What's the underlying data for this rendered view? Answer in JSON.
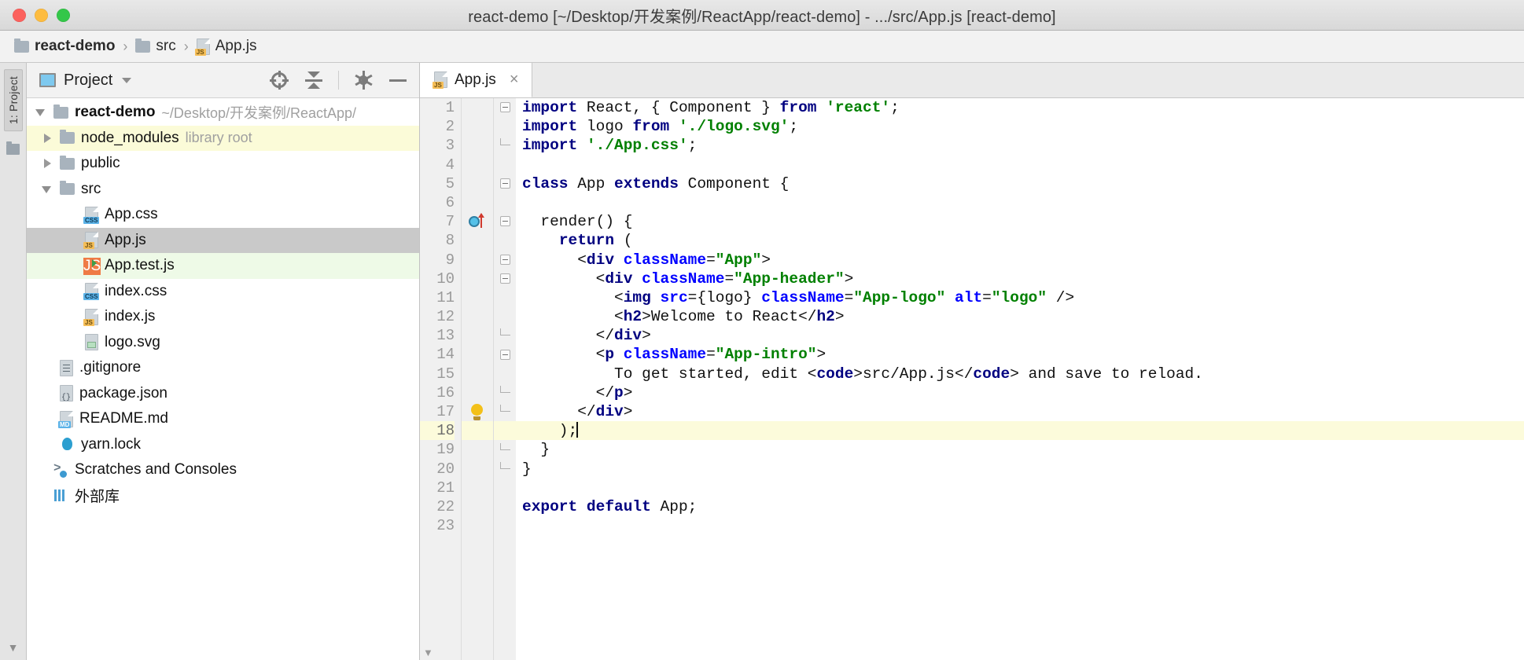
{
  "window": {
    "title": "react-demo [~/Desktop/开发案例/ReactApp/react-demo] - .../src/App.js [react-demo]",
    "controls": {
      "close": "close-button",
      "minimize": "minimize-button",
      "maximize": "maximize-button"
    }
  },
  "breadcrumb": {
    "items": [
      {
        "label": "react-demo",
        "icon": "folder-icon",
        "bold": true
      },
      {
        "label": "src",
        "icon": "folder-icon",
        "bold": false
      },
      {
        "label": "App.js",
        "icon": "js-file-icon",
        "bold": false
      }
    ],
    "separator": "›"
  },
  "toolstrip": {
    "tab_label": "1: Project"
  },
  "project_panel": {
    "title": "Project",
    "dropdown_caret": "▾",
    "actions": [
      {
        "name": "locate-in-tree-button",
        "icon": "target-icon"
      },
      {
        "name": "collapse-all-button",
        "icon": "collapse-all-icon"
      },
      {
        "name": "settings-button",
        "icon": "gear-icon"
      },
      {
        "name": "hide-panel-button",
        "icon": "minimize-icon"
      }
    ],
    "tree": [
      {
        "label": "react-demo",
        "meta": "~/Desktop/开发案例/ReactApp/",
        "icon": "folder-icon",
        "twisty": "open",
        "indent": 0,
        "bold": true,
        "state": "none"
      },
      {
        "label": "node_modules",
        "meta": "library root",
        "icon": "folder-icon",
        "twisty": "closed",
        "indent": 1,
        "bold": false,
        "state": "yellow"
      },
      {
        "label": "public",
        "meta": "",
        "icon": "folder-icon",
        "twisty": "closed",
        "indent": 1,
        "bold": false,
        "state": "none"
      },
      {
        "label": "src",
        "meta": "",
        "icon": "folder-icon",
        "twisty": "open",
        "indent": 1,
        "bold": false,
        "state": "none"
      },
      {
        "label": "App.css",
        "meta": "",
        "icon": "css-file-icon",
        "twisty": "none",
        "indent": 2,
        "bold": false,
        "state": "none"
      },
      {
        "label": "App.js",
        "meta": "",
        "icon": "js-file-icon",
        "twisty": "none",
        "indent": 2,
        "bold": false,
        "state": "selected"
      },
      {
        "label": "App.test.js",
        "meta": "",
        "icon": "js-test-file-icon",
        "twisty": "none",
        "indent": 2,
        "bold": false,
        "state": "green"
      },
      {
        "label": "index.css",
        "meta": "",
        "icon": "css-file-icon",
        "twisty": "none",
        "indent": 2,
        "bold": false,
        "state": "none"
      },
      {
        "label": "index.js",
        "meta": "",
        "icon": "js-file-icon",
        "twisty": "none",
        "indent": 2,
        "bold": false,
        "state": "none"
      },
      {
        "label": "logo.svg",
        "meta": "",
        "icon": "svg-file-icon",
        "twisty": "none",
        "indent": 2,
        "bold": false,
        "state": "none"
      },
      {
        "label": ".gitignore",
        "meta": "",
        "icon": "gitignore-file-icon",
        "twisty": "none",
        "indent": 1,
        "bold": false,
        "state": "none"
      },
      {
        "label": "package.json",
        "meta": "",
        "icon": "json-file-icon",
        "twisty": "none",
        "indent": 1,
        "bold": false,
        "state": "none"
      },
      {
        "label": "README.md",
        "meta": "",
        "icon": "md-file-icon",
        "twisty": "none",
        "indent": 1,
        "bold": false,
        "state": "none"
      },
      {
        "label": "yarn.lock",
        "meta": "",
        "icon": "yarn-file-icon",
        "twisty": "none",
        "indent": 1,
        "bold": false,
        "state": "none"
      },
      {
        "label": "Scratches and Consoles",
        "meta": "",
        "icon": "scratches-icon",
        "twisty": "none",
        "indent": 0,
        "bold": false,
        "state": "none"
      },
      {
        "label": "外部库",
        "meta": "",
        "icon": "external-libraries-icon",
        "twisty": "none",
        "indent": 0,
        "bold": false,
        "state": "none"
      }
    ]
  },
  "editor": {
    "tabs": [
      {
        "label": "App.js",
        "icon": "js-file-icon",
        "close": "×",
        "active": true
      }
    ],
    "current_line": 18,
    "gutter_markers": [
      {
        "line": 7,
        "type": "override-method-icon"
      },
      {
        "line": 17,
        "type": "intention-bulb-icon"
      }
    ],
    "lines": [
      {
        "n": 1,
        "text": "import React, { Component } from 'react';"
      },
      {
        "n": 2,
        "text": "import logo from './logo.svg';"
      },
      {
        "n": 3,
        "text": "import './App.css';"
      },
      {
        "n": 4,
        "text": ""
      },
      {
        "n": 5,
        "text": "class App extends Component {"
      },
      {
        "n": 6,
        "text": ""
      },
      {
        "n": 7,
        "text": "  render() {"
      },
      {
        "n": 8,
        "text": "    return ("
      },
      {
        "n": 9,
        "text": "      <div className=\"App\">"
      },
      {
        "n": 10,
        "text": "        <div className=\"App-header\">"
      },
      {
        "n": 11,
        "text": "          <img src={logo} className=\"App-logo\" alt=\"logo\" />"
      },
      {
        "n": 12,
        "text": "          <h2>Welcome to React</h2>"
      },
      {
        "n": 13,
        "text": "        </div>"
      },
      {
        "n": 14,
        "text": "        <p className=\"App-intro\">"
      },
      {
        "n": 15,
        "text": "          To get started, edit <code>src/App.js</code> and save to reload."
      },
      {
        "n": 16,
        "text": "        </p>"
      },
      {
        "n": 17,
        "text": "      </div>"
      },
      {
        "n": 18,
        "text": "    );"
      },
      {
        "n": 19,
        "text": "  }"
      },
      {
        "n": 20,
        "text": "}"
      },
      {
        "n": 21,
        "text": ""
      },
      {
        "n": 22,
        "text": "export default App;"
      },
      {
        "n": 23,
        "text": ""
      }
    ]
  },
  "colors": {
    "keyword": "#000080",
    "string": "#008000",
    "attribute": "#0000ff",
    "current_line_bg": "#fcfbdb",
    "selection_bg": "#c9c9c9",
    "tab_accent": "#f0c05a"
  }
}
